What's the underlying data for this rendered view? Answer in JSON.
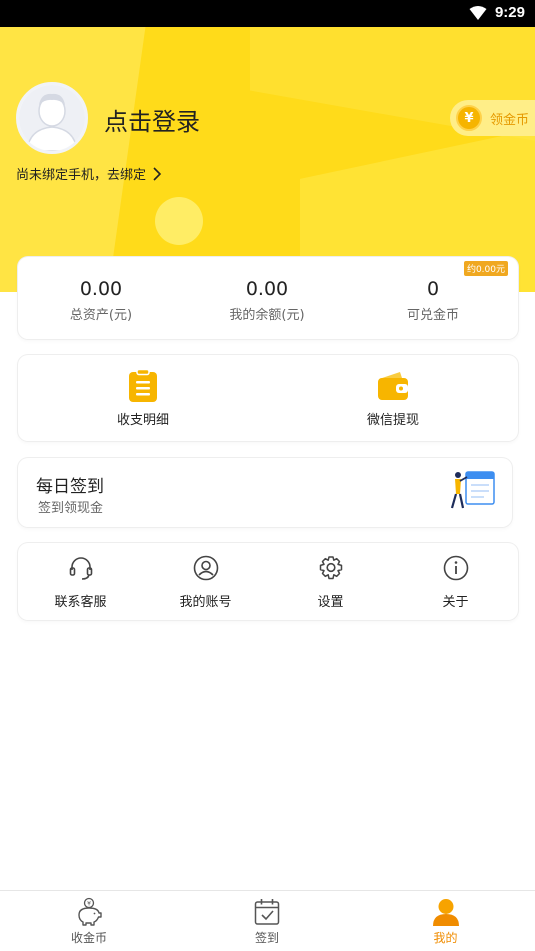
{
  "status_bar": {
    "time": "9:29"
  },
  "header": {
    "login_label": "点击登录",
    "bind_phone_text": "尚未绑定手机，去绑定",
    "coin_button_label": "领金币",
    "coin_symbol": "¥"
  },
  "assets": {
    "badge": "约0.00元",
    "items": [
      {
        "value": "0.00",
        "label": "总资产(元)"
      },
      {
        "value": "0.00",
        "label": "我的余额(元)"
      },
      {
        "value": "0",
        "label": "可兑金币"
      }
    ]
  },
  "actions": {
    "items": [
      {
        "label": "收支明细",
        "icon": "clipboard-icon"
      },
      {
        "label": "微信提现",
        "icon": "wallet-icon"
      }
    ]
  },
  "checkin": {
    "title": "每日签到",
    "subtitle": "签到领现金"
  },
  "menu": {
    "items": [
      {
        "label": "联系客服",
        "icon": "headset-icon"
      },
      {
        "label": "我的账号",
        "icon": "user-circle-icon"
      },
      {
        "label": "设置",
        "icon": "gear-icon"
      },
      {
        "label": "关于",
        "icon": "info-icon"
      }
    ]
  },
  "tabbar": {
    "active": "我的",
    "items": [
      {
        "label": "收金币",
        "icon": "piggy-bank-icon"
      },
      {
        "label": "签到",
        "icon": "calendar-check-icon"
      },
      {
        "label": "我的",
        "icon": "person-icon"
      }
    ]
  },
  "colors": {
    "brand_yellow": "#FFDB1A",
    "accent_orange": "#F08C00",
    "icon_gold": "#F7B500"
  }
}
